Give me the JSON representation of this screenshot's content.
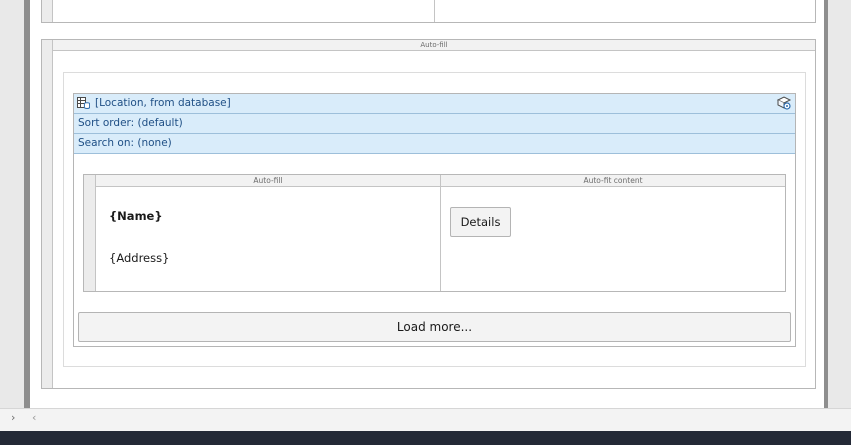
{
  "outer_section": {
    "header_label": "Auto-fill"
  },
  "repeater": {
    "source_label": "[Location, from database]",
    "sort_order": "Sort order: (default)",
    "search_on": "Search on: (none)",
    "source_icon": "database-table-icon",
    "settings_icon": "data-settings-icon"
  },
  "item_table": {
    "col1_header": "Auto-fill",
    "col2_header": "Auto-fit content",
    "name_field": "{Name}",
    "address_field": "{Address}",
    "details_button": "Details"
  },
  "load_more_button": "Load more...",
  "nav": {
    "forward_icon": "chevron-right-icon",
    "back_icon": "chevron-left-icon"
  },
  "colors": {
    "accent_row_bg": "#d9ecfa",
    "accent_text": "#1f4f85",
    "status_bar": "#232936"
  }
}
